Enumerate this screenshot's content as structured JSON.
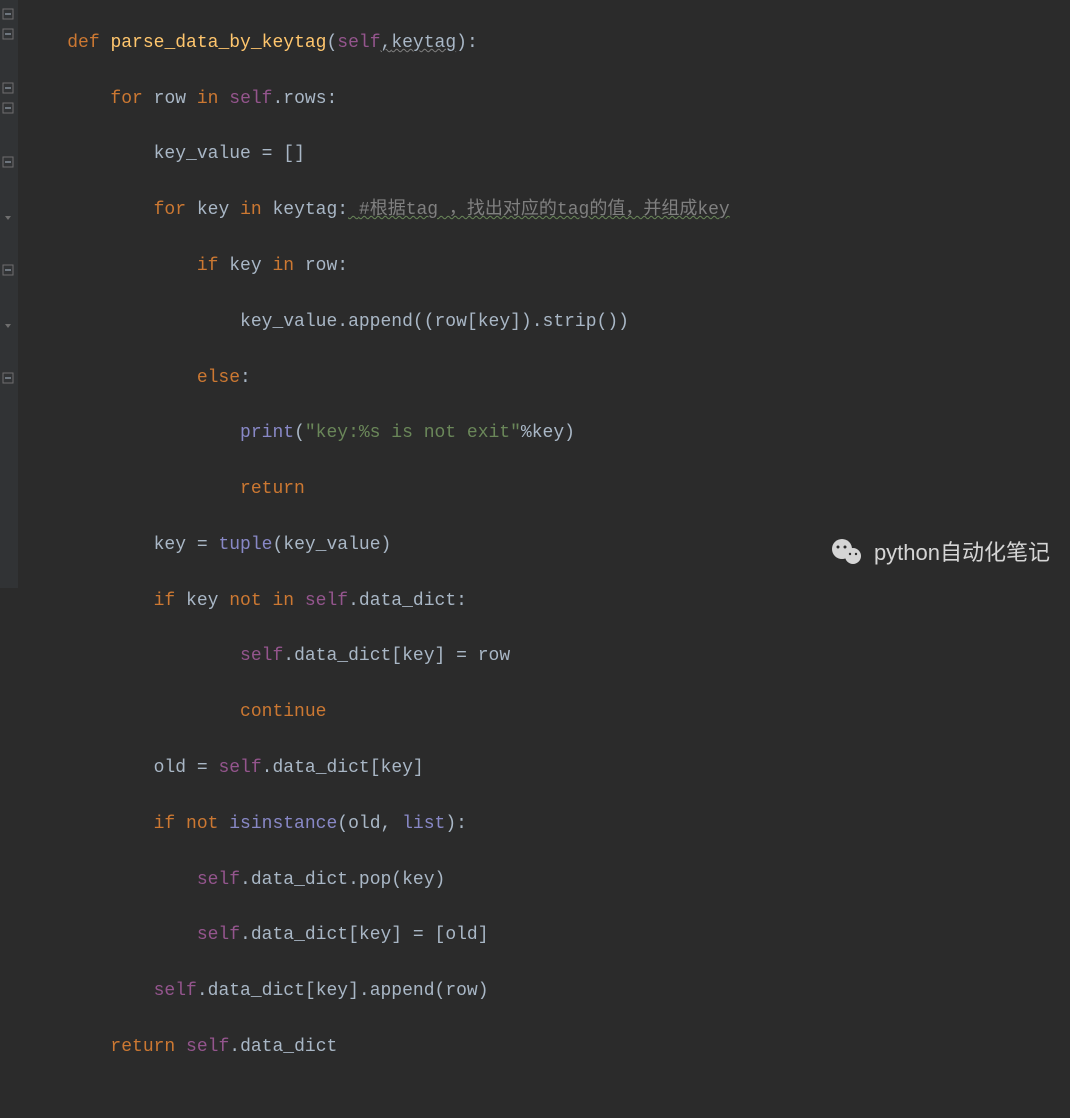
{
  "code": {
    "l1": {
      "def": "def ",
      "fn": "parse_data_by_keytag",
      "open": "(",
      "self": "self",
      "comma": ",",
      "p2": "keytag",
      "close": "):"
    },
    "l2": {
      "for": "for ",
      "var": "row ",
      "in": "in ",
      "self": "self",
      "dot": ".",
      "attr": "rows",
      "colon": ":"
    },
    "l3": {
      "lhs": "key_value ",
      "eq": "= ",
      "rhs": "[]"
    },
    "l4": {
      "for": "for ",
      "var": "key ",
      "in": "in ",
      "iter": "keytag",
      "colon": ":",
      "sp": " ",
      "comment": "#根据tag ，找出对应的tag的值，并组成key"
    },
    "l5": {
      "if": "if ",
      "var": "key ",
      "in": "in ",
      "obj": "row",
      "colon": ":"
    },
    "l6": {
      "obj": "key_value",
      "dot": ".",
      "m": "append",
      "open": "((",
      "r": "row",
      "br": "[",
      "k": "key",
      "cb": "]).",
      "m2": "strip",
      "end": "())"
    },
    "l7": {
      "else": "else",
      "colon": ":"
    },
    "l8": {
      "fn": "print",
      "open": "(",
      "str": "\"key:%s is not exit\"",
      "op": "%",
      "var": "key",
      "close": ")"
    },
    "l9": {
      "ret": "return"
    },
    "l10": {
      "lhs": "key ",
      "eq": "= ",
      "fn": "tuple",
      "open": "(",
      "arg": "key_value",
      "close": ")"
    },
    "l11": {
      "if": "if ",
      "var": "key ",
      "not": "not in ",
      "self": "self",
      "dot": ".",
      "attr": "data_dict",
      "colon": ":"
    },
    "l12": {
      "self": "self",
      "dot": ".",
      "attr": "data_dict",
      "br": "[",
      "k": "key",
      "cb": "] = ",
      "rhs": "row"
    },
    "l13": {
      "cont": "continue"
    },
    "l14": {
      "lhs": "old ",
      "eq": "= ",
      "self": "self",
      "dot": ".",
      "attr": "data_dict",
      "br": "[",
      "k": "key",
      "cb": "]"
    },
    "l15": {
      "if": "if not ",
      "fn": "isinstance",
      "open": "(",
      "a1": "old",
      "comma": ", ",
      "a2": "list",
      "close": "):"
    },
    "l16": {
      "self": "self",
      "dot": ".",
      "attr": "data_dict",
      "dot2": ".",
      "m": "pop",
      "open": "(",
      "arg": "key",
      "close": ")"
    },
    "l17": {
      "self": "self",
      "dot": ".",
      "attr": "data_dict",
      "br": "[",
      "k": "key",
      "cb": "] = [",
      "v": "old",
      "end": "]"
    },
    "l18": {
      "self": "self",
      "dot": ".",
      "attr": "data_dict",
      "br": "[",
      "k": "key",
      "cb": "].",
      "m": "append",
      "open": "(",
      "arg": "row",
      "close": ")"
    },
    "l19": {
      "ret": "return ",
      "self": "self",
      "dot": ".",
      "attr": "data_dict"
    }
  },
  "watermark": {
    "text": "python自动化笔记"
  },
  "indent": {
    "i1": "    ",
    "i2": "        ",
    "i3": "            ",
    "i4": "                ",
    "i5": "                    ",
    "i6": "                        "
  }
}
